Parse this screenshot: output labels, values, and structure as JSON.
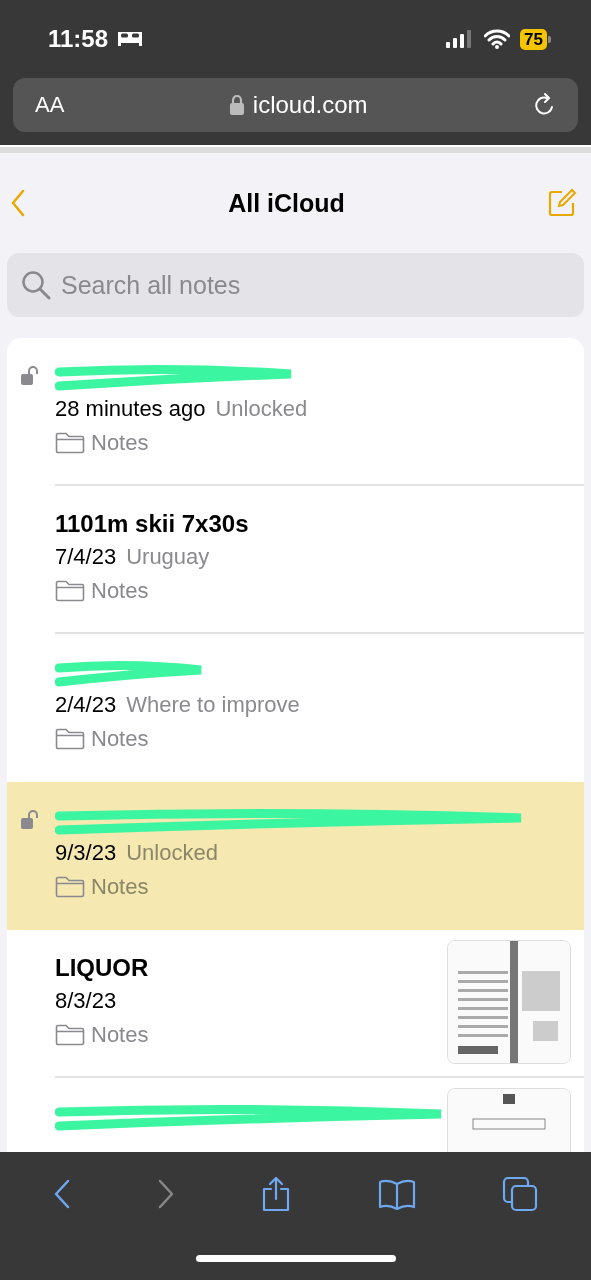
{
  "status_bar": {
    "time": "11:58",
    "battery": "75"
  },
  "address_bar": {
    "text_size_button": "AA",
    "url": "icloud.com"
  },
  "nav": {
    "title": "All iCloud"
  },
  "search": {
    "placeholder": "Search all notes"
  },
  "notes": [
    {
      "locked_icon": true,
      "title_redacted": true,
      "date": "28 minutes ago",
      "snippet": "Unlocked",
      "folder": "Notes",
      "selected": false
    },
    {
      "locked_icon": false,
      "title_redacted": false,
      "title": "1101m skii 7x30s",
      "date": "7/4/23",
      "snippet": "Uruguay",
      "folder": "Notes",
      "selected": false
    },
    {
      "locked_icon": false,
      "title_redacted": true,
      "date": "2/4/23",
      "snippet": "Where to improve",
      "folder": "Notes",
      "selected": false
    },
    {
      "locked_icon": true,
      "title_redacted": true,
      "date": "9/3/23",
      "snippet": "Unlocked",
      "folder": "Notes",
      "selected": true
    },
    {
      "locked_icon": false,
      "title_redacted": false,
      "title": "LIQUOR",
      "date": "8/3/23",
      "folder": "Notes",
      "selected": false
    },
    {
      "locked_icon": false,
      "title_redacted": true,
      "selected": false
    }
  ]
}
